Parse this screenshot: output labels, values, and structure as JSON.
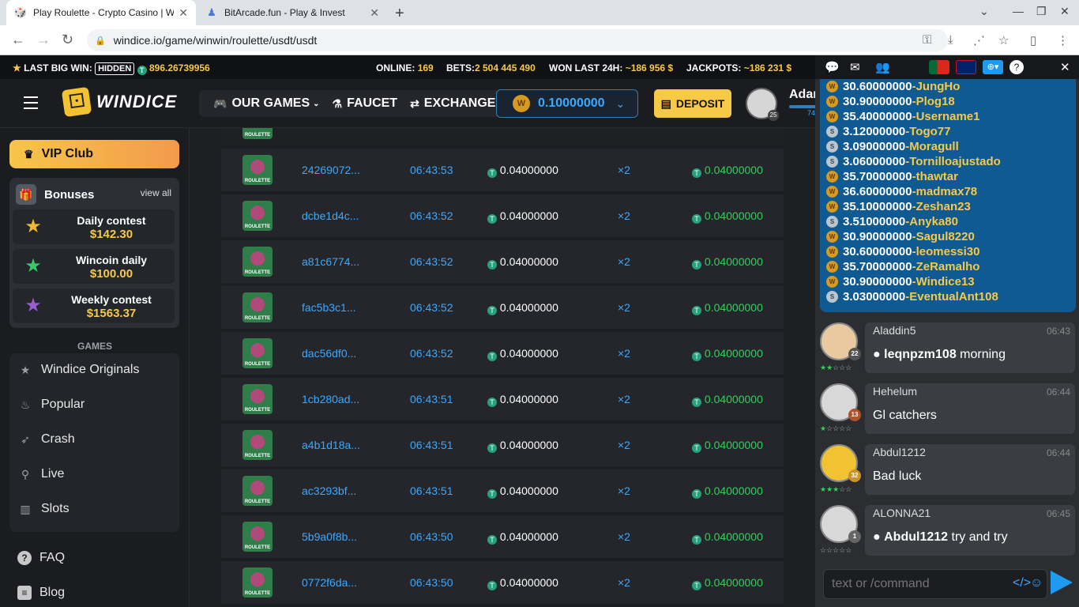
{
  "browser": {
    "tabs": [
      {
        "title": "Play Roulette - Crypto Casino | W"
      },
      {
        "title": "BitArcade.fun - Play & Invest"
      }
    ],
    "url": "windice.io/game/winwin/roulette/usdt/usdt"
  },
  "ticker": {
    "last_big_win_label": "LAST BIG WIN:",
    "hidden_label": "HIDDEN",
    "last_big_win_value": "896.26739956",
    "online_label": "ONLINE:",
    "online_value": "169",
    "bets_label": "BETS:",
    "bets_value": "2 504 445 490",
    "won_label": "WON LAST 24H:",
    "won_value": "~186 956 $",
    "jackpots_label": "JACKPOTS:",
    "jackpots_value": "~186 231 $"
  },
  "header": {
    "logo_text": "WINDICE",
    "nav": [
      "OUR GAMES",
      "FAUCET",
      "EXCHANGE"
    ],
    "balance": "0.10000000",
    "deposit_label": "DEPOSIT",
    "avatar_level": "25",
    "username": "Adar",
    "user_progress": "74"
  },
  "sidebar": {
    "vip_label": "VIP Club",
    "bonuses_label": "Bonuses",
    "view_all_label": "view all",
    "contests": [
      {
        "name": "Daily contest",
        "value": "$142.30"
      },
      {
        "name": "Wincoin daily",
        "value": "$100.00"
      },
      {
        "name": "Weekly contest",
        "value": "$1563.37"
      }
    ],
    "games_title": "GAMES",
    "games": [
      "Windice Originals",
      "Popular",
      "Crash",
      "Live",
      "Slots"
    ],
    "faq_label": "FAQ",
    "blog_label": "Blog"
  },
  "bets": {
    "game_label": "ROULETTE",
    "rows": [
      {
        "id": "24269072...",
        "time": "06:43:53",
        "bet": "0.04000000",
        "mult": "×2",
        "win": "0.04000000"
      },
      {
        "id": "dcbe1d4c...",
        "time": "06:43:52",
        "bet": "0.04000000",
        "mult": "×2",
        "win": "0.04000000"
      },
      {
        "id": "a81c6774...",
        "time": "06:43:52",
        "bet": "0.04000000",
        "mult": "×2",
        "win": "0.04000000"
      },
      {
        "id": "fac5b3c1...",
        "time": "06:43:52",
        "bet": "0.04000000",
        "mult": "×2",
        "win": "0.04000000"
      },
      {
        "id": "dac56df0...",
        "time": "06:43:52",
        "bet": "0.04000000",
        "mult": "×2",
        "win": "0.04000000"
      },
      {
        "id": "1cb280ad...",
        "time": "06:43:51",
        "bet": "0.04000000",
        "mult": "×2",
        "win": "0.04000000"
      },
      {
        "id": "a4b1d18a...",
        "time": "06:43:51",
        "bet": "0.04000000",
        "mult": "×2",
        "win": "0.04000000"
      },
      {
        "id": "ac3293bf...",
        "time": "06:43:51",
        "bet": "0.04000000",
        "mult": "×2",
        "win": "0.04000000"
      },
      {
        "id": "5b9a0f8b...",
        "time": "06:43:50",
        "bet": "0.04000000",
        "mult": "×2",
        "win": "0.04000000"
      },
      {
        "id": "0772f6da...",
        "time": "06:43:50",
        "bet": "0.04000000",
        "mult": "×2",
        "win": "0.04000000"
      }
    ]
  },
  "chat": {
    "winners": [
      {
        "amount": "30.60000000",
        "name": "-JungHo",
        "coin": "gold"
      },
      {
        "amount": "30.90000000",
        "name": "-Plog18",
        "coin": "gold"
      },
      {
        "amount": "35.40000000",
        "name": "-Username1",
        "coin": "gold"
      },
      {
        "amount": "3.12000000",
        "name": "-Togo77",
        "coin": "silver"
      },
      {
        "amount": "3.09000000",
        "name": "-Moragull",
        "coin": "silver"
      },
      {
        "amount": "3.06000000",
        "name": "-Tornilloajustado",
        "coin": "silver"
      },
      {
        "amount": "35.70000000",
        "name": "-thawtar",
        "coin": "gold"
      },
      {
        "amount": "36.60000000",
        "name": "-madmax78",
        "coin": "gold"
      },
      {
        "amount": "35.10000000",
        "name": "-Zeshan23",
        "coin": "gold"
      },
      {
        "amount": "3.51000000",
        "name": "-Anyka80",
        "coin": "silver"
      },
      {
        "amount": "30.90000000",
        "name": "-Sagul8220",
        "coin": "gold"
      },
      {
        "amount": "30.60000000",
        "name": "-leomessi30",
        "coin": "gold"
      },
      {
        "amount": "35.70000000",
        "name": "-ZeRamalho",
        "coin": "gold"
      },
      {
        "amount": "30.90000000",
        "name": "-Windice13",
        "coin": "gold"
      },
      {
        "amount": "3.03000000",
        "name": "-EventualAnt108",
        "coin": "silver"
      }
    ],
    "messages": [
      {
        "user": "Aladdin5",
        "time": "06:43",
        "level": "22",
        "mention": "leqnpzm108",
        "text": " morning"
      },
      {
        "user": "Hehelum",
        "time": "06:44",
        "level": "13",
        "mention": "",
        "text": "Gl catchers"
      },
      {
        "user": "Abdul1212",
        "time": "06:44",
        "level": "32",
        "mention": "",
        "text": "Bad luck"
      },
      {
        "user": "ALONNA21",
        "time": "06:45",
        "level": "1",
        "mention": "Abdul1212",
        "text": " try and try"
      }
    ],
    "input_placeholder": "text or /command"
  }
}
